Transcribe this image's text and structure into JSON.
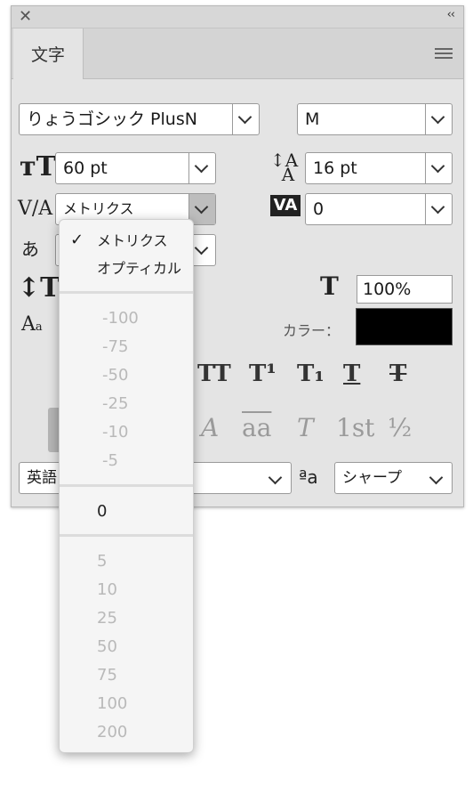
{
  "panel": {
    "tab_label": "文字",
    "font_family": "りょうゴシック PlusN",
    "font_style": "M",
    "font_size": "60 pt",
    "leading": "16 pt",
    "kerning": "メトリクス",
    "tracking": "0",
    "horizontal_scale": "100%",
    "color_label": "カラー：",
    "color_value": "#000000",
    "language": "英語",
    "antialias": "シャープ",
    "antialias_icon": "ªa"
  },
  "format_buttons": [
    "TT",
    "T¹",
    "T₁",
    "T",
    "T"
  ],
  "opentype_buttons": [
    "A",
    "aa",
    "T",
    "1st",
    "½"
  ],
  "dropdown": {
    "options_text": [
      "メトリクス",
      "オプティカル"
    ],
    "options_neg": [
      "-100",
      "-75",
      "-50",
      "-25",
      "-10",
      "-5"
    ],
    "option_zero": "0",
    "options_pos": [
      "5",
      "10",
      "25",
      "50",
      "75",
      "100",
      "200"
    ],
    "checked": "メトリクス"
  }
}
